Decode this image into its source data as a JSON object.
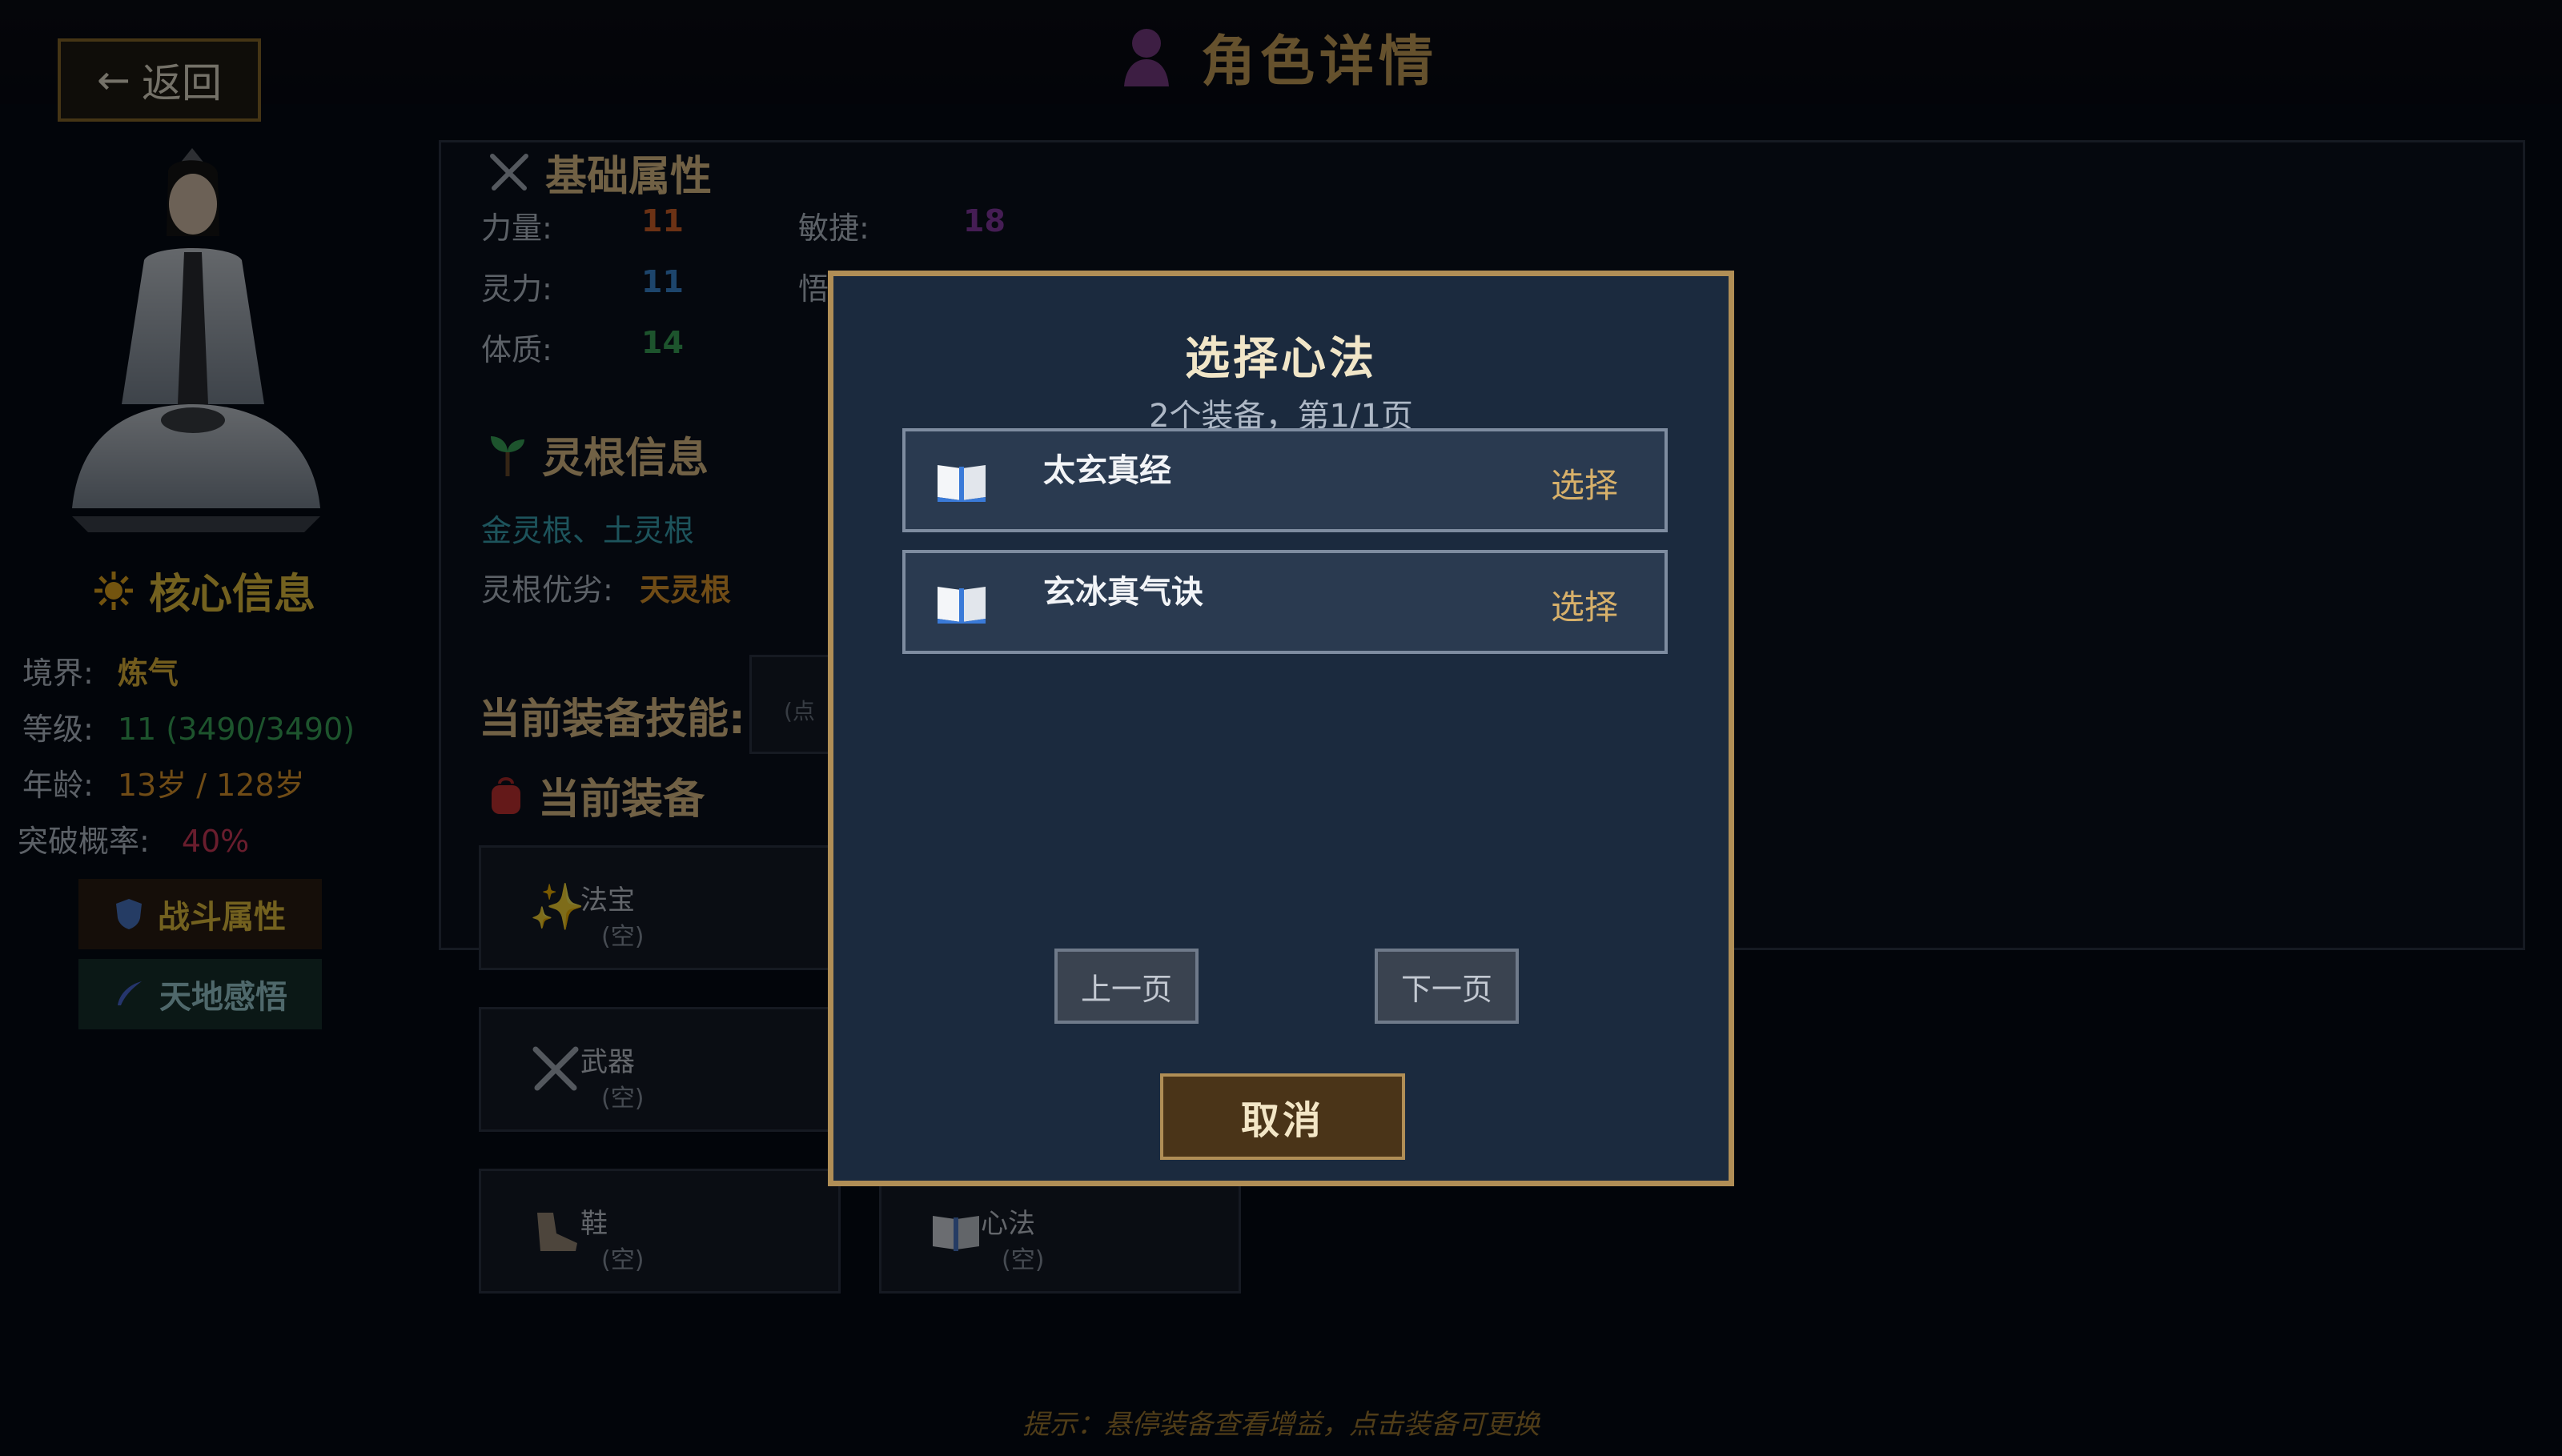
{
  "header": {
    "back_label": "返回",
    "title": "角色详情"
  },
  "core": {
    "title": "核心信息",
    "rows": [
      {
        "label": "境界:",
        "value": "炼气",
        "color": "#e5b83a"
      },
      {
        "label": "等级:",
        "value": "11 (3490/3490)",
        "color": "#3aa85a"
      },
      {
        "label": "年龄:",
        "value": "13岁 / 128岁",
        "color": "#e0982c"
      },
      {
        "label": "突破概率:",
        "value": "40%",
        "color": "#d23a5a"
      }
    ],
    "battle_btn": "战斗属性",
    "insight_btn": "天地感悟"
  },
  "attributes": {
    "title": "基础属性",
    "strength_label": "力量:",
    "strength": "11",
    "agility_label": "敏捷:",
    "agility": "18",
    "spirit_label": "灵力:",
    "spirit": "11",
    "wisdom_label": "悟",
    "constitution_label": "体质:",
    "constitution": "14"
  },
  "root": {
    "title": "灵根信息",
    "types": "金灵根、土灵根",
    "quality_label": "灵根优劣:",
    "quality": "天灵根"
  },
  "skills": {
    "title": "当前装备技能:",
    "slot_placeholder": "(点"
  },
  "equipment": {
    "title": "当前装备",
    "slots": [
      {
        "name": "法宝",
        "status": "(空)"
      },
      {
        "name": "武器",
        "status": "(空)"
      },
      {
        "name": "鞋",
        "status": "(空)"
      },
      {
        "name": "心法",
        "status": "(空)"
      }
    ]
  },
  "hint": "提示：悬停装备查看增益，点击装备可更换",
  "modal": {
    "title": "选择心法",
    "subtitle": "2个装备，第1/1页",
    "items": [
      {
        "name": "太玄真经",
        "action": "选择"
      },
      {
        "name": "玄冰真气诀",
        "action": "选择"
      }
    ],
    "prev": "上一页",
    "next": "下一页",
    "cancel": "取消"
  },
  "colors": {
    "gold": "#e7c23e",
    "strength": "#d9642a",
    "agility": "#8a3aa8",
    "spirit": "#3a8ad8",
    "constitution": "#3aa85a",
    "root_types": "#3aa8b8",
    "root_quality": "#e0982c"
  }
}
